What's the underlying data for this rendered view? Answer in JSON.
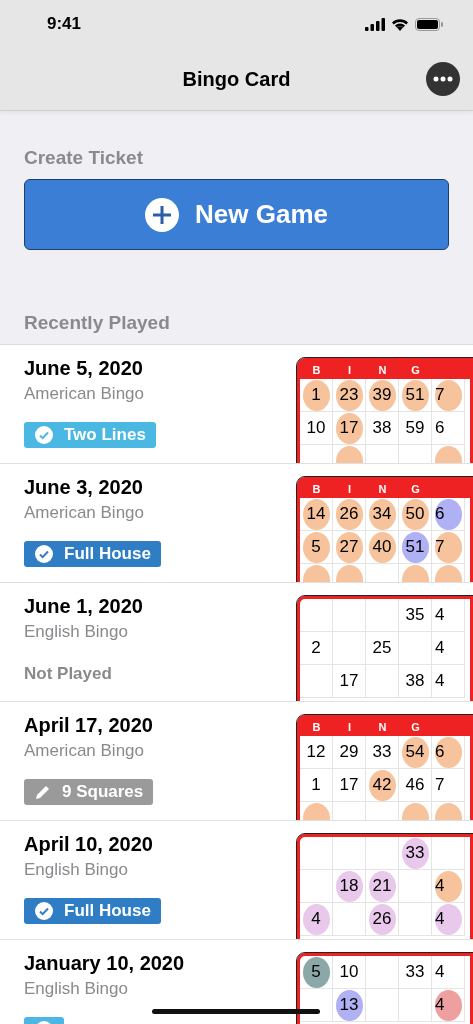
{
  "status_bar": {
    "time": "9:41"
  },
  "nav": {
    "title": "Bingo Card"
  },
  "create": {
    "heading": "Create Ticket",
    "button": "New Game"
  },
  "recent": {
    "heading": "Recently Played",
    "games": [
      {
        "date": "June 5, 2020",
        "type": "American Bingo",
        "badge": {
          "kind": "check",
          "label": "Two Lines",
          "color": "#4bb8e3"
        },
        "card": {
          "header": [
            "B",
            "I",
            "N",
            "G"
          ],
          "rows": [
            [
              {
                "n": "1",
                "color": "#f7c39c"
              },
              {
                "n": "23",
                "color": "#f7c39c"
              },
              {
                "n": "39",
                "color": "#f7c39c"
              },
              {
                "n": "51",
                "color": "#f7c39c"
              },
              {
                "n": "7",
                "color": "#f7c39c"
              }
            ],
            [
              {
                "n": "10"
              },
              {
                "n": "17",
                "color": "#f7c39c"
              },
              {
                "n": "38"
              },
              {
                "n": "59"
              },
              {
                "n": "6"
              }
            ],
            [
              {},
              {
                "color": "#f7c39c"
              },
              {},
              {},
              {
                "color": "#f7c39c"
              }
            ]
          ]
        }
      },
      {
        "date": "June 3, 2020",
        "type": "American Bingo",
        "badge": {
          "kind": "check",
          "label": "Full House",
          "color": "#2f7dc4"
        },
        "card": {
          "header": [
            "B",
            "I",
            "N",
            "G"
          ],
          "rows": [
            [
              {
                "n": "14",
                "color": "#f7c39c"
              },
              {
                "n": "26",
                "color": "#f7c39c"
              },
              {
                "n": "34",
                "color": "#f7c39c"
              },
              {
                "n": "50",
                "color": "#f7c39c"
              },
              {
                "n": "6",
                "color": "#b0b0f5"
              }
            ],
            [
              {
                "n": "5",
                "color": "#f7c39c"
              },
              {
                "n": "27",
                "color": "#f7c39c"
              },
              {
                "n": "40",
                "color": "#f7c39c"
              },
              {
                "n": "51",
                "color": "#b0b0f5"
              },
              {
                "n": "7",
                "color": "#f7c39c"
              }
            ],
            [
              {
                "color": "#f7c39c"
              },
              {
                "color": "#f7c39c"
              },
              {},
              {
                "color": "#f7c39c"
              },
              {
                "color": "#f7c39c"
              }
            ]
          ]
        }
      },
      {
        "date": "June 1, 2020",
        "type": "English Bingo",
        "badge": {
          "kind": "text",
          "label": "Not Played"
        },
        "card": {
          "rows": [
            [
              {},
              {},
              {},
              {
                "n": "35"
              },
              {
                "n": "4"
              }
            ],
            [
              {
                "n": "2"
              },
              {},
              {
                "n": "25"
              },
              {},
              {
                "n": "4"
              }
            ],
            [
              {},
              {
                "n": "17"
              },
              {},
              {
                "n": "38"
              },
              {
                "n": "4"
              }
            ]
          ]
        }
      },
      {
        "date": "April 17, 2020",
        "type": "American Bingo",
        "badge": {
          "kind": "pencil",
          "label": "9 Squares",
          "color": "#9a9a9a"
        },
        "card": {
          "header": [
            "B",
            "I",
            "N",
            "G"
          ],
          "rows": [
            [
              {
                "n": "12"
              },
              {
                "n": "29"
              },
              {
                "n": "33"
              },
              {
                "n": "54",
                "color": "#f7c39c"
              },
              {
                "n": "6",
                "color": "#f7c39c"
              }
            ],
            [
              {
                "n": "1"
              },
              {
                "n": "17"
              },
              {
                "n": "42",
                "color": "#f7c39c"
              },
              {
                "n": "46"
              },
              {
                "n": "7"
              }
            ],
            [
              {
                "color": "#f7c39c"
              },
              {},
              {},
              {
                "color": "#f7c39c"
              },
              {
                "color": "#f7c39c"
              }
            ]
          ]
        }
      },
      {
        "date": "April 10, 2020",
        "type": "English Bingo",
        "badge": {
          "kind": "check",
          "label": "Full House",
          "color": "#2f7dc4"
        },
        "card": {
          "rows": [
            [
              {},
              {},
              {},
              {
                "n": "33",
                "color": "#e8c9ec"
              },
              {}
            ],
            [
              {},
              {
                "n": "18",
                "color": "#e8c9ec"
              },
              {
                "n": "21",
                "color": "#e8c9ec"
              },
              {},
              {
                "n": "4",
                "color": "#f7c39c"
              }
            ],
            [
              {
                "n": "4",
                "color": "#e8c9ec"
              },
              {},
              {
                "n": "26",
                "color": "#e8c9ec"
              },
              {},
              {
                "n": "4",
                "color": "#e8c9ec"
              }
            ]
          ]
        }
      },
      {
        "date": "January 10, 2020",
        "type": "English Bingo",
        "badge": {
          "kind": "check",
          "color": "#4bb8e3"
        },
        "card": {
          "rows": [
            [
              {
                "n": "5",
                "color": "#8aa8a8"
              },
              {
                "n": "10"
              },
              {},
              {
                "n": "33"
              },
              {
                "n": "4"
              }
            ],
            [
              {},
              {
                "n": "13",
                "color": "#b0b0f5"
              },
              {},
              {},
              {
                "n": "4",
                "color": "#ee9fa0"
              }
            ]
          ]
        }
      }
    ]
  }
}
